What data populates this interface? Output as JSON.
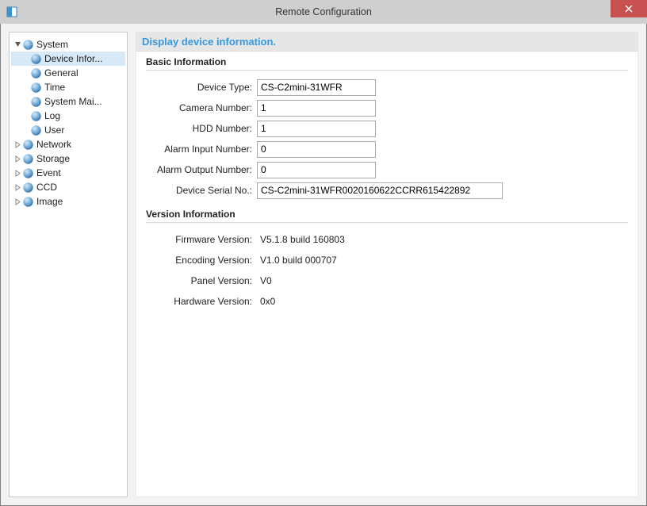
{
  "window": {
    "title": "Remote Configuration"
  },
  "tree": {
    "system": {
      "label": "System",
      "expanded": true
    },
    "device_info": {
      "label": "Device Infor..."
    },
    "general": {
      "label": "General"
    },
    "time": {
      "label": "Time"
    },
    "system_maint": {
      "label": "System Mai..."
    },
    "log": {
      "label": "Log"
    },
    "user": {
      "label": "User"
    },
    "network": {
      "label": "Network"
    },
    "storage": {
      "label": "Storage"
    },
    "event": {
      "label": "Event"
    },
    "ccd": {
      "label": "CCD"
    },
    "image": {
      "label": "Image"
    }
  },
  "page": {
    "header": "Display device information."
  },
  "sections": {
    "basic": {
      "title": "Basic Information"
    },
    "version": {
      "title": "Version Information"
    }
  },
  "basic": {
    "device_type": {
      "label": "Device Type:",
      "value": "CS-C2mini-31WFR"
    },
    "camera_number": {
      "label": "Camera Number:",
      "value": "1"
    },
    "hdd_number": {
      "label": "HDD Number:",
      "value": "1"
    },
    "alarm_in": {
      "label": "Alarm Input Number:",
      "value": "0"
    },
    "alarm_out": {
      "label": "Alarm Output Number:",
      "value": "0"
    },
    "serial": {
      "label": "Device Serial No.:",
      "value": "CS-C2mini-31WFR0020160622CCRR615422892"
    }
  },
  "version": {
    "firmware": {
      "label": "Firmware Version:",
      "value": "V5.1.8 build 160803"
    },
    "encoding": {
      "label": "Encoding Version:",
      "value": "V1.0 build 000707"
    },
    "panel": {
      "label": "Panel Version:",
      "value": "V0"
    },
    "hardware": {
      "label": "Hardware Version:",
      "value": "0x0"
    }
  }
}
